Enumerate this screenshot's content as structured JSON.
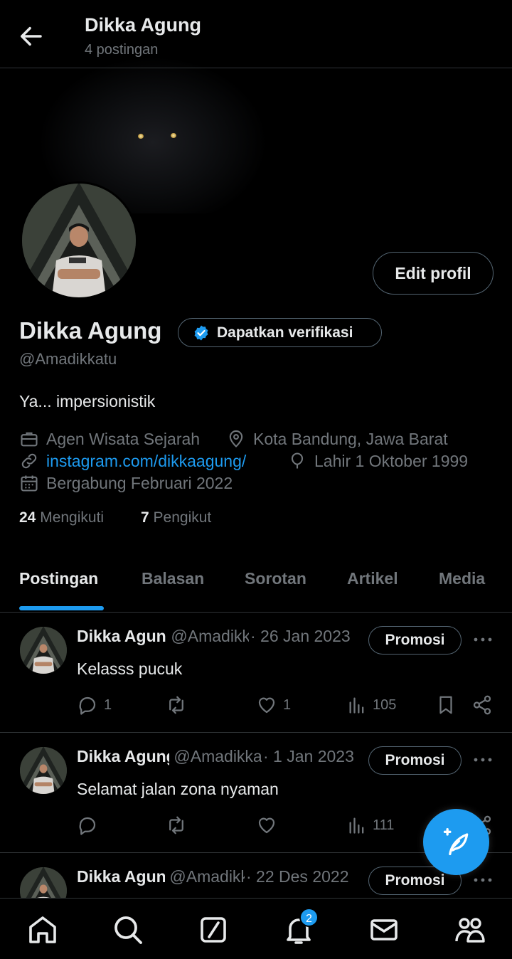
{
  "header": {
    "title": "Dikka Agung",
    "subtitle": "4 postingan"
  },
  "profile": {
    "edit_label": "Edit profil",
    "name": "Dikka Agung",
    "verify_label": "Dapatkan verifikasi",
    "handle": "@Amadikkatu",
    "bio": "Ya... impersionistik",
    "job": "Agen Wisata Sejarah",
    "location": "Kota Bandung, Jawa Barat",
    "website": "instagram.com/dikkaagung/",
    "birthday": "Lahir 1 Oktober 1999",
    "joined": "Bergabung Februari 2022",
    "following_count": "24",
    "following_label": "Mengikuti",
    "followers_count": "7",
    "followers_label": "Pengikut"
  },
  "tabs": [
    {
      "label": "Postingan"
    },
    {
      "label": "Balasan"
    },
    {
      "label": "Sorotan"
    },
    {
      "label": "Artikel"
    },
    {
      "label": "Media"
    }
  ],
  "posts": [
    {
      "name": "Dikka Agung",
      "handle": "@Amadikkatu",
      "date": "· 26 Jan 2023",
      "promo": "Promosi",
      "text": "Kelasss pucuk",
      "replies": "1",
      "reposts": "",
      "likes": "1",
      "views": "105"
    },
    {
      "name": "Dikka Agung",
      "handle": "@Amadikkatu",
      "date": "· 1 Jan 2023",
      "promo": "Promosi",
      "text": "Selamat jalan zona nyaman",
      "replies": "",
      "reposts": "",
      "likes": "",
      "views": "111"
    },
    {
      "name": "Dikka Agung",
      "handle": "@Amadikkatu",
      "date": "· 22 Des 2022",
      "promo": "Promosi",
      "text": "",
      "replies": "",
      "reposts": "",
      "likes": "",
      "views": ""
    }
  ],
  "notifications_badge": "2",
  "colors": {
    "accent": "#1d9bf0",
    "text": "#e7e9ea",
    "muted": "#71767b",
    "border": "#2f3336"
  }
}
